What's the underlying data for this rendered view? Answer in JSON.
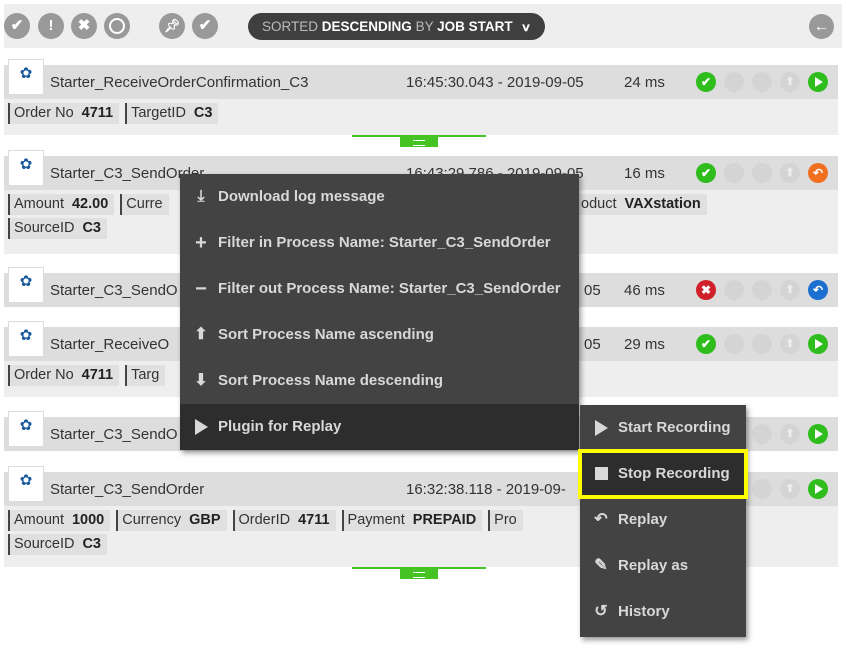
{
  "toolbar": {
    "filter_icons": [
      "check-icon",
      "exclamation-icon",
      "x-icon",
      "circle-icon"
    ],
    "action_icons": [
      "pin-icon",
      "check-icon"
    ],
    "sort": {
      "prefix": "SORTED",
      "direction": "DESCENDING",
      "by": "BY",
      "field": "JOB START"
    },
    "back_icon": "arrow-left-icon"
  },
  "entries": [
    {
      "process_name": "Starter_ReceiveOrderConfirmation_C3",
      "timestamp": "16:45:30.043 - 2019-09-05",
      "duration": "24 ms",
      "status": "success",
      "action": "play",
      "attributes": [
        [
          {
            "key": "Order No",
            "value": "4711"
          },
          {
            "key": "TargetID",
            "value": "C3"
          }
        ]
      ]
    },
    {
      "process_name": "Starter_C3_SendOrder",
      "timestamp": "16:43:29.786 - 2019-09-05",
      "duration": "16 ms",
      "status": "success",
      "action": "replay-orange",
      "attributes": [
        [
          {
            "key": "Amount",
            "value": "42.00"
          },
          {
            "key": "Curre",
            "value": ""
          },
          {
            "key": "oduct",
            "value": "VAXstation"
          }
        ],
        [
          {
            "key": "SourceID",
            "value": "C3"
          }
        ]
      ]
    },
    {
      "process_name": "Starter_C3_SendO",
      "timestamp": "05",
      "duration": "46 ms",
      "status": "error",
      "action": "replay-blue",
      "attributes": []
    },
    {
      "process_name": "Starter_ReceiveO",
      "timestamp": "05",
      "duration": "29 ms",
      "status": "success",
      "action": "play",
      "attributes": [
        [
          {
            "key": "Order No",
            "value": "4711"
          },
          {
            "key": "Targ",
            "value": ""
          }
        ]
      ]
    },
    {
      "process_name": "Starter_C3_SendO",
      "timestamp": "",
      "duration": "",
      "status": "",
      "action": "play",
      "attributes": []
    },
    {
      "process_name": "Starter_C3_SendOrder",
      "timestamp": "16:32:38.118 - 2019-09-",
      "duration": "",
      "status": "",
      "action": "play",
      "attributes": [
        [
          {
            "key": "Amount",
            "value": "1000"
          },
          {
            "key": "Currency",
            "value": "GBP"
          },
          {
            "key": "OrderID",
            "value": "4711"
          },
          {
            "key": "Payment",
            "value": "PREPAID"
          },
          {
            "key": "Pro",
            "value": ""
          }
        ],
        [
          {
            "key": "SourceID",
            "value": "C3"
          }
        ]
      ]
    }
  ],
  "context_menu": {
    "items": [
      {
        "icon": "download-icon",
        "label": "Download log message"
      },
      {
        "icon": "plus-icon",
        "label": "Filter in Process Name: Starter_C3_SendOrder"
      },
      {
        "icon": "minus-icon",
        "label": "Filter out Process Name: Starter_C3_SendOrder"
      },
      {
        "icon": "arrow-up-icon",
        "label": "Sort Process Name ascending"
      },
      {
        "icon": "arrow-down-icon",
        "label": "Sort Process Name descending"
      },
      {
        "icon": "play-icon",
        "label": "Plugin for Replay"
      }
    ]
  },
  "submenu": {
    "items": [
      {
        "icon": "play-icon",
        "label": "Start Recording"
      },
      {
        "icon": "stop-icon",
        "label": "Stop Recording",
        "highlight_color": "#ffff00"
      },
      {
        "icon": "reply-icon",
        "label": "Replay"
      },
      {
        "icon": "pencil-icon",
        "label": "Replay as"
      },
      {
        "icon": "history-icon",
        "label": "History"
      }
    ]
  },
  "colors": {
    "success": "#2ebd1c",
    "error": "#d0202a",
    "replay_orange": "#f07020",
    "replay_blue": "#1a6fd0",
    "highlight": "#ffff00",
    "menu_bg": "#434343"
  }
}
